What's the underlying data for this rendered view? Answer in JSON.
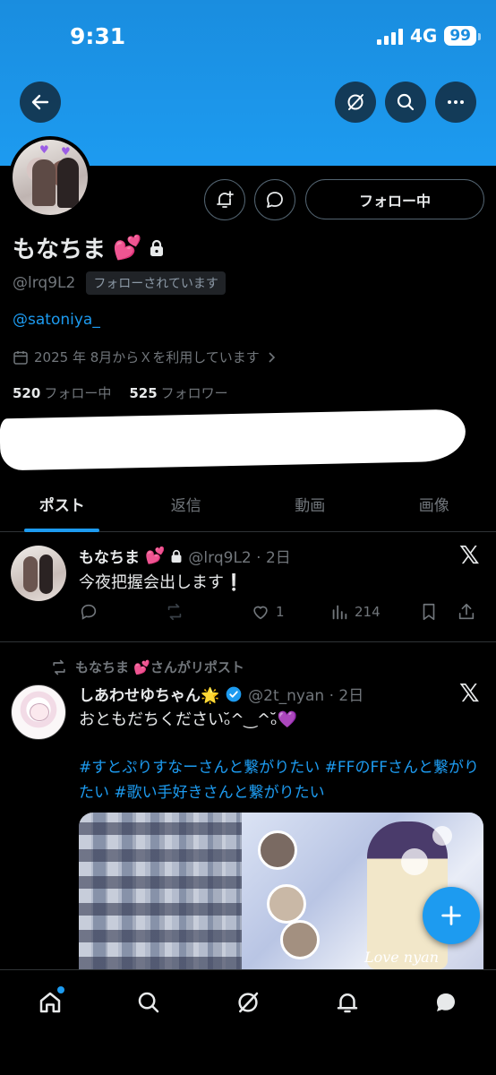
{
  "status_bar": {
    "time": "9:31",
    "network": "4G",
    "battery": "99"
  },
  "profile": {
    "display_name": "もなちま",
    "name_emoji": "💕",
    "handle": "@lrq9L2",
    "follows_you_badge": "フォローされています",
    "bio_link": "@satoniya_",
    "joined": "2025 年 8月からＸを利用しています",
    "following_count": "520",
    "following_label": "フォロー中",
    "followers_count": "525",
    "followers_label": "フォロワー",
    "follow_button": "フォロー中"
  },
  "tabs": [
    "ポスト",
    "返信",
    "動画",
    "画像"
  ],
  "posts": [
    {
      "name": "もなちま",
      "emoji": "💕",
      "handle_time": "@lrq9L2 · 2日",
      "text": "今夜把握会出します❕",
      "reply_count": "",
      "repost_count": "",
      "like_count": "1",
      "view_count": "214"
    },
    {
      "repost_label": "もなちま 💕さんがリポスト",
      "name": "しあわせゆちゃん🌟",
      "handle_time": "@2t_nyan · 2日",
      "text": "おともだちくださいₒ̆^‿^ₒ̆💜",
      "hashtags": "#すとぷりすなーさんと繋がりたい #FFのFFさんと繋がりたい #歌い手好きさんと繋がりたい",
      "media_caption": "Love nyan"
    }
  ],
  "colors": {
    "accent": "#1d9bf0",
    "banner": "#1d9bf0",
    "background": "#000000"
  }
}
